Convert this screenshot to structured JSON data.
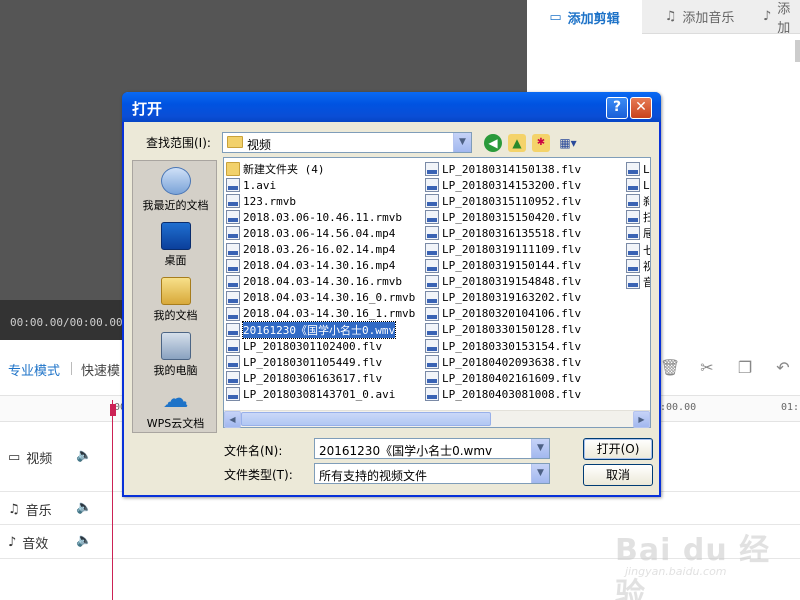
{
  "app": {
    "timecode": "00:00.00/00:00.00",
    "tabs": [
      {
        "label": "添加剪辑",
        "icon": "video-camera-icon"
      },
      {
        "label": "添加音乐",
        "icon": "music-note-icon"
      },
      {
        "label": "添加",
        "icon": "sound-effect-icon"
      }
    ],
    "modes": {
      "active": "专业模式",
      "other": "快速模"
    },
    "ruler": [
      "00",
      ":00.00",
      "01:"
    ],
    "tracks": [
      {
        "label": "视频",
        "icon": "video-camera-icon"
      },
      {
        "label": "音乐",
        "icon": "music-note-icon"
      },
      {
        "label": "音效",
        "icon": "sound-effect-icon"
      }
    ]
  },
  "dialog": {
    "title": "打开",
    "help_label": "?",
    "close_label": "✕",
    "look_in_label": "查找范围(I):",
    "look_in_value": "视频",
    "places": [
      "我最近的文档",
      "桌面",
      "我的文档",
      "我的电脑",
      "WPS云文档"
    ],
    "files_col1": [
      {
        "name": "新建文件夹 (4)",
        "type": "folder"
      },
      {
        "name": "1.avi",
        "type": "file"
      },
      {
        "name": "123.rmvb",
        "type": "file"
      },
      {
        "name": "2018.03.06-10.46.11.rmvb",
        "type": "file"
      },
      {
        "name": "2018.03.06-14.56.04.mp4",
        "type": "file"
      },
      {
        "name": "2018.03.26-16.02.14.mp4",
        "type": "file"
      },
      {
        "name": "2018.04.03-14.30.16.mp4",
        "type": "file"
      },
      {
        "name": "2018.04.03-14.30.16.rmvb",
        "type": "file"
      },
      {
        "name": "2018.04.03-14.30.16_0.rmvb",
        "type": "file"
      },
      {
        "name": "2018.04.03-14.30.16_1.rmvb",
        "type": "file"
      },
      {
        "name": "20161230《国学小名士0.wmv",
        "type": "file",
        "selected": true
      },
      {
        "name": "LP_20180301102400.flv",
        "type": "file"
      },
      {
        "name": "LP_20180301105449.flv",
        "type": "file"
      },
      {
        "name": "LP_20180306163617.flv",
        "type": "file"
      },
      {
        "name": "LP_20180308143701_0.avi",
        "type": "file"
      }
    ],
    "files_col2": [
      "LP_20180314150138.flv",
      "LP_20180314153200.flv",
      "LP_20180315110952.flv",
      "LP_20180315150420.flv",
      "LP_20180316135518.flv",
      "LP_20180319111109.flv",
      "LP_20180319150144.flv",
      "LP_20180319154848.flv",
      "LP_20180319163202.flv",
      "LP_20180320104106.flv",
      "LP_20180330150128.flv",
      "LP_20180330153154.flv",
      "LP_20180402093638.flv",
      "LP_20180402161609.flv",
      "LP_20180403081008.flv"
    ],
    "files_col3": [
      "L",
      "L",
      "刹",
      "扫",
      "屉",
      "七",
      "视",
      "音"
    ],
    "filename_label": "文件名(N):",
    "filename_value": "20161230《国学小名士0.wmv",
    "filetype_label": "文件类型(T):",
    "filetype_value": "所有支持的视频文件",
    "open_button": "打开(O)",
    "cancel_button": "取消"
  },
  "watermark": {
    "logo": "Bai du 经验",
    "url": "jingyan.baidu.com"
  }
}
